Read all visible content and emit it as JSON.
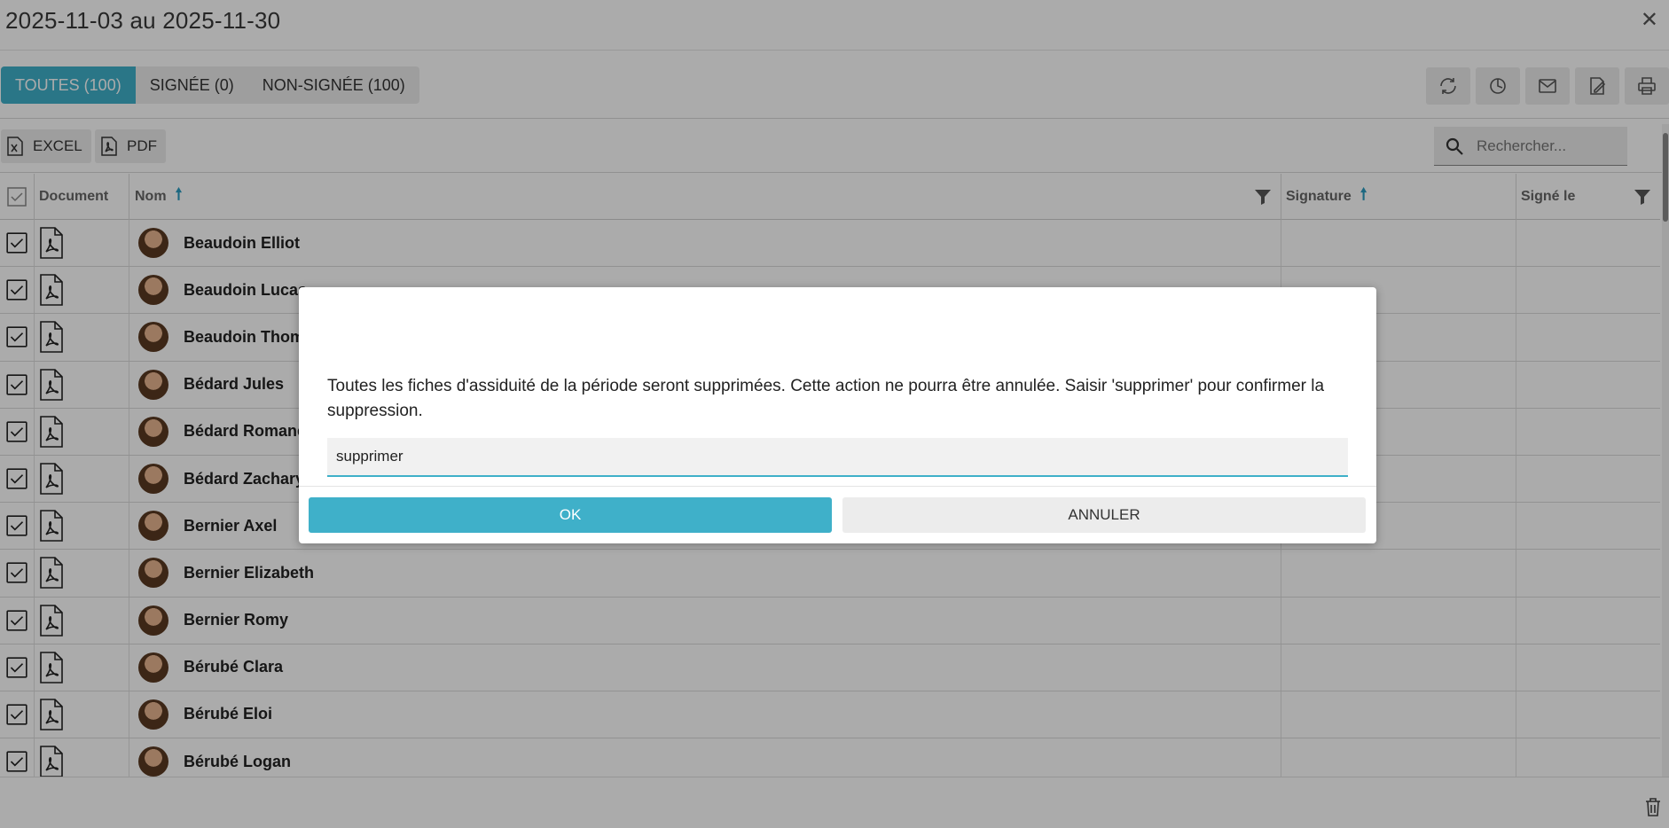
{
  "header": {
    "title": "2025-11-03 au 2025-11-30",
    "close_label": "✕"
  },
  "tabs": [
    {
      "label": "TOUTES (100)",
      "active": true
    },
    {
      "label": "SIGNÉE (0)",
      "active": false
    },
    {
      "label": "NON-SIGNÉE (100)",
      "active": false
    }
  ],
  "actions": [
    "refresh-icon",
    "clock-icon",
    "mail-icon",
    "sign-icon",
    "print-icon"
  ],
  "toolbar": {
    "excel_label": "EXCEL",
    "pdf_label": "PDF",
    "search_placeholder": "Rechercher..."
  },
  "table": {
    "columns": {
      "document": "Document",
      "name": "Nom",
      "signature": "Signature",
      "signed_on": "Signé le"
    },
    "rows": [
      {
        "name": "Beaudoin Elliot"
      },
      {
        "name": "Beaudoin Lucas"
      },
      {
        "name": "Beaudoin Thomas"
      },
      {
        "name": "Bédard Jules"
      },
      {
        "name": "Bédard Romane"
      },
      {
        "name": "Bédard Zachary"
      },
      {
        "name": "Bernier Axel"
      },
      {
        "name": "Bernier Elizabeth"
      },
      {
        "name": "Bernier Romy"
      },
      {
        "name": "Bérubé Clara"
      },
      {
        "name": "Bérubé Eloi"
      },
      {
        "name": "Bérubé Logan"
      }
    ]
  },
  "dialog": {
    "message": "Toutes les fiches d'assiduité de la période seront supprimées. Cette action ne pourra être annulée. Saisir 'supprimer' pour confirmer la suppression.",
    "input_value": "supprimer",
    "ok_label": "OK",
    "cancel_label": "ANNULER"
  },
  "colors": {
    "accent": "#3fb0c9",
    "sort_arrow": "#2a9bc0"
  }
}
